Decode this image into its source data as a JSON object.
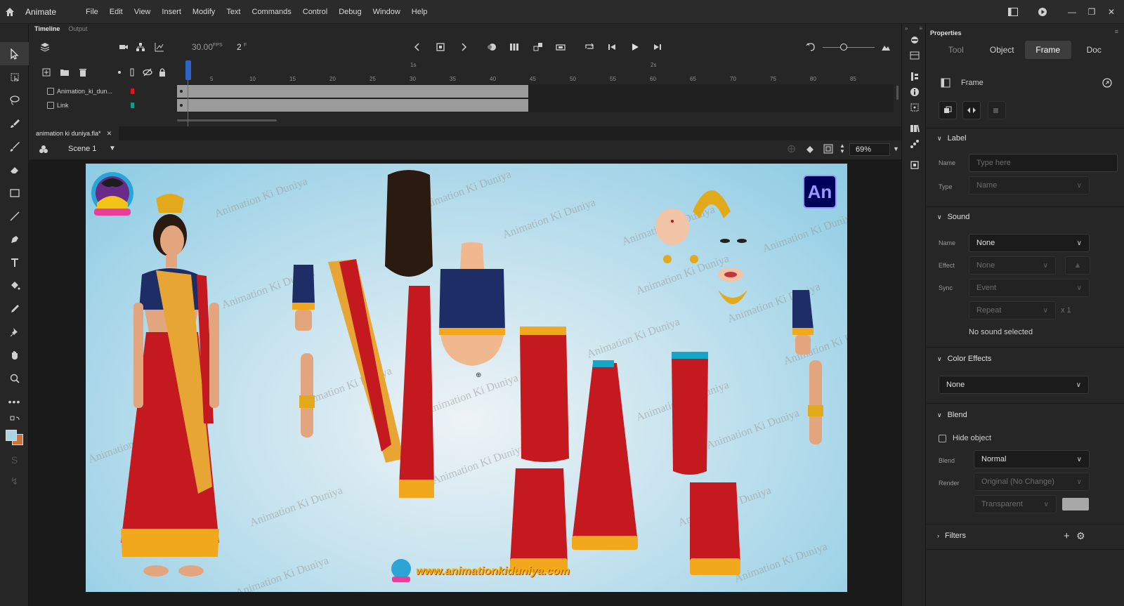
{
  "app": {
    "name": "Animate"
  },
  "menu": [
    "File",
    "Edit",
    "View",
    "Insert",
    "Modify",
    "Text",
    "Commands",
    "Control",
    "Debug",
    "Window",
    "Help"
  ],
  "timeline": {
    "tabs": [
      "Timeline",
      "Output"
    ],
    "fps": "30.00",
    "fps_unit": "FPS",
    "current_frame": "2",
    "frame_unit": "F",
    "ruler_ticks": [
      "5",
      "10",
      "15",
      "20",
      "25",
      "30",
      "35",
      "40",
      "45",
      "50",
      "55",
      "60",
      "65",
      "70",
      "75",
      "80",
      "85"
    ],
    "ruler_seconds": [
      "1s",
      "2s"
    ],
    "layers": [
      {
        "name": "Animation_ki_dun...",
        "color": "#e0141b"
      },
      {
        "name": "Link",
        "color": "#0f9b8e"
      }
    ]
  },
  "document": {
    "tab_title": "animation ki duniya.fla*",
    "scene": "Scene 1",
    "zoom": "69%"
  },
  "stage": {
    "watermark": "Animation Ki Duniya",
    "logo_text": "An",
    "website": "www.animationkiduniya.com"
  },
  "properties": {
    "title": "Properties",
    "tabs": [
      "Tool",
      "Object",
      "Frame",
      "Doc"
    ],
    "active_tab": "Frame",
    "header": "Frame",
    "label_section": {
      "title": "Label",
      "name_label": "Name",
      "name_placeholder": "Type here",
      "type_label": "Type",
      "type_value": "Name"
    },
    "sound_section": {
      "title": "Sound",
      "name_label": "Name",
      "name_value": "None",
      "effect_label": "Effect",
      "effect_value": "None",
      "sync_label": "Sync",
      "sync_value": "Event",
      "repeat_value": "Repeat",
      "repeat_count": "x 1",
      "status": "No sound selected"
    },
    "color_effects": {
      "title": "Color Effects",
      "value": "None"
    },
    "blend_section": {
      "title": "Blend",
      "hide_object": "Hide object",
      "blend_label": "Blend",
      "blend_value": "Normal",
      "render_label": "Render",
      "render_value": "Original (No Change)",
      "transparent_value": "Transparent"
    },
    "filters": {
      "title": "Filters"
    }
  }
}
